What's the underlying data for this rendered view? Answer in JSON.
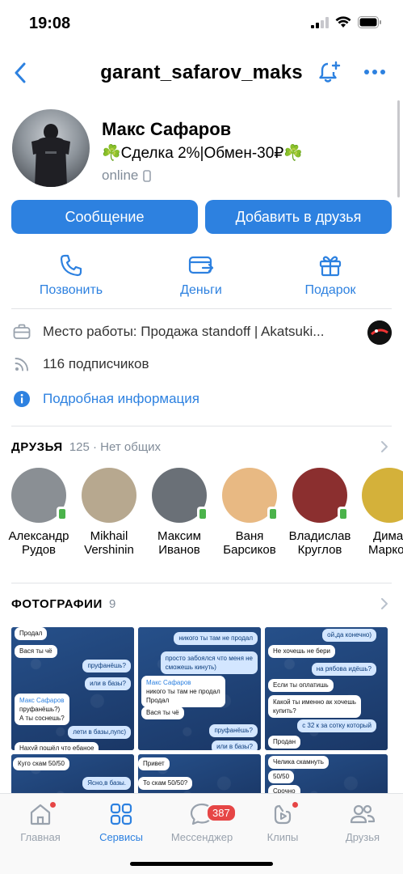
{
  "status_bar": {
    "time": "19:08"
  },
  "nav": {
    "title": "garant_safarov_maks"
  },
  "profile": {
    "name": "Макс Сафаров",
    "status": "☘️Сделка 2%|Обмен-30₽☘️",
    "online": "online"
  },
  "buttons": {
    "message": "Сообщение",
    "add_friend": "Добавить в друзья"
  },
  "actions": [
    {
      "label": "Позвонить",
      "icon": "phone-icon"
    },
    {
      "label": "Деньги",
      "icon": "money-icon"
    },
    {
      "label": "Подарок",
      "icon": "gift-icon"
    }
  ],
  "info": {
    "work": "Место работы: Продажа standoff | Akatsuki...",
    "followers": "116 подписчиков",
    "details": "Подробная информация"
  },
  "friends_section": {
    "title": "ДРУЗЬЯ",
    "count": "125 · Нет общих",
    "items": [
      {
        "first": "Александр",
        "last": "Рудов",
        "color": "#8a8f94"
      },
      {
        "first": "Mikhail",
        "last": "Vershinin",
        "color": "#b7a88f"
      },
      {
        "first": "Максим",
        "last": "Иванов",
        "color": "#6a7077"
      },
      {
        "first": "Ваня",
        "last": "Барсиков",
        "color": "#e8b983"
      },
      {
        "first": "Владислав",
        "last": "Круглов",
        "color": "#8b2f2f"
      },
      {
        "first": "Дима",
        "last": "Марко",
        "color": "#d4b13a"
      }
    ]
  },
  "photos_section": {
    "title": "ФОТОГРАФИИ",
    "count": "9",
    "photo1": {
      "m1": "Продал",
      "m2": "Вася ты чё",
      "m3": "пруфанёшь?",
      "m4": "или в базы?",
      "q_name": "Макс Сафаров",
      "q_text": "пруфанёшь?)",
      "m5": "А ты соснешь?",
      "m6": "лети в базы,лупс)",
      "m7": "Нахуй пошёл что ебаное"
    },
    "photo2": {
      "m1": "никого ты там не продал",
      "m2": "просто забоялся что меня не",
      "m3": "сможешь кинуть)",
      "q_name": "Макс Сафаров",
      "q_text": "никого ты там не продал",
      "m4": "Продал",
      "m5": "Вася ты чё",
      "m6": "пруфанёшь?",
      "m7": "или в базы?"
    },
    "photo3": {
      "m1": "ой,да конечно)",
      "m2": "Не хочешь не бери",
      "m3": "на рябова идёшь?",
      "m4": "Если ты оплатишь",
      "m5": "Какой ты именно ак хочешь",
      "m6": "купить?",
      "m7": "с 32 к за сотку который",
      "m8": "Продан"
    },
    "photo4": {
      "m1": "Куго скам 50/50",
      "m2": "Ясно,в базы."
    },
    "photo5": {
      "m1": "Привет",
      "m2": "То скам 50/50?"
    },
    "photo6": {
      "m1": "Челика скамнуть",
      "m2": "50/50",
      "m3": "Срочно"
    }
  },
  "tabbar": {
    "tabs": [
      {
        "label": "Главная"
      },
      {
        "label": "Сервисы"
      },
      {
        "label": "Мессенджер",
        "badge": "387"
      },
      {
        "label": "Клипы"
      },
      {
        "label": "Друзья"
      }
    ]
  },
  "colors": {
    "accent": "#2d81e0",
    "muted": "#818c99",
    "badge": "#e64646",
    "online": "#4bb34b"
  }
}
